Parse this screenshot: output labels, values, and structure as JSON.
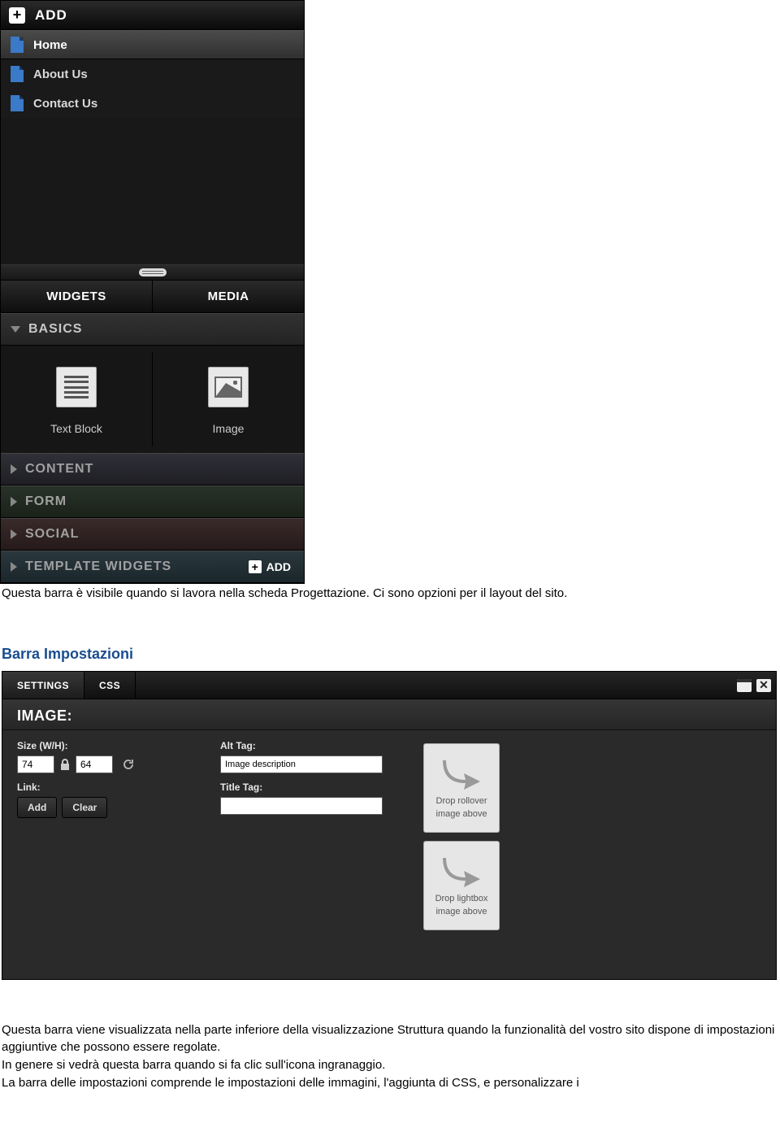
{
  "sidebar": {
    "add_label": "ADD",
    "pages": [
      {
        "label": "Home",
        "active": true
      },
      {
        "label": "About Us",
        "active": false
      },
      {
        "label": "Contact Us",
        "active": false
      }
    ],
    "tabs": {
      "widgets": "WIDGETS",
      "media": "MEDIA"
    },
    "sections": {
      "basics": "BASICS",
      "content": "CONTENT",
      "form": "FORM",
      "social": "SOCIAL",
      "template": "TEMPLATE WIDGETS",
      "template_add": "ADD"
    },
    "widgets": {
      "text_block": "Text Block",
      "image": "Image"
    }
  },
  "para1": "Questa barra è visibile quando si lavora nella scheda Progettazione. Ci sono opzioni per il layout del sito.",
  "heading1": "Barra Impostazioni",
  "settings": {
    "tabs": {
      "settings": "SETTINGS",
      "css": "CSS"
    },
    "title": "IMAGE:",
    "size_label": "Size (W/H):",
    "size_w": "74",
    "size_h": "64",
    "link_label": "Link:",
    "btn_add": "Add",
    "btn_clear": "Clear",
    "alt_label": "Alt Tag:",
    "alt_value": "Image description",
    "title_tag_label": "Title Tag:",
    "title_tag_value": "",
    "dz_rollover_l1": "Drop rollover",
    "dz_rollover_l2": "image above",
    "dz_lightbox_l1": "Drop lightbox",
    "dz_lightbox_l2": "image above"
  },
  "para2": "Questa barra viene visualizzata nella parte inferiore della visualizzazione Struttura quando la funzionalità del vostro sito dispone di impostazioni aggiuntive che possono essere regolate.",
  "para3": "In genere si vedrà questa barra quando si fa clic sull'icona ingranaggio.",
  "para4": "La barra delle impostazioni comprende le impostazioni delle immagini, l'aggiunta di CSS, e personalizzare i"
}
